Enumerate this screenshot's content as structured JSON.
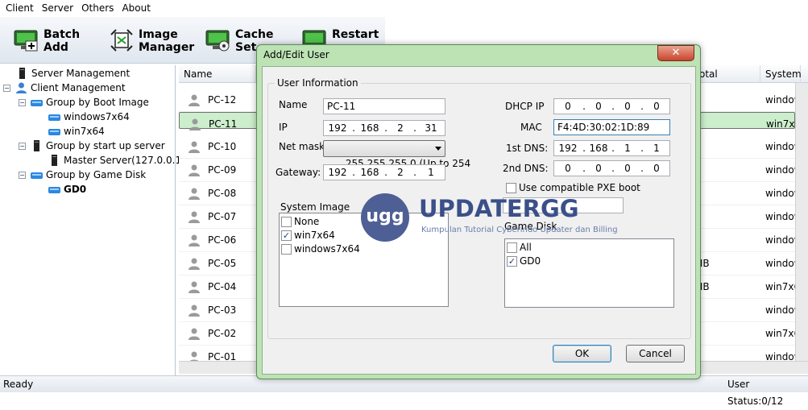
{
  "menu": [
    "Client",
    "Server",
    "Others",
    "About"
  ],
  "toolbar": {
    "batch_add": "Batch\nAdd",
    "image_manager": "Image\nManager",
    "cache_settings": "Cache\nSet",
    "restart": "Restart"
  },
  "tree": {
    "server_management": "Server Management",
    "client_management": "Client Management",
    "group_boot_image": "Group by Boot Image",
    "boot_image_1": "windows7x64",
    "boot_image_2": "win7x64",
    "group_startup_server": "Group by start up server",
    "master_server": "Master Server(127.0.0.1)",
    "group_game_disk": "Group by Game Disk",
    "game_disk_1": "GD0"
  },
  "grid": {
    "col_name": "Name",
    "col_total": "otal",
    "col_system": "System",
    "rows": [
      {
        "name": "PC-12",
        "total": "",
        "system": "window"
      },
      {
        "name": "PC-11",
        "total": "",
        "system": "win7x6"
      },
      {
        "name": "PC-10",
        "total": "",
        "system": "window"
      },
      {
        "name": "PC-09",
        "total": "",
        "system": "window"
      },
      {
        "name": "PC-08",
        "total": "",
        "system": "window"
      },
      {
        "name": "PC-07",
        "total": "",
        "system": "window"
      },
      {
        "name": "PC-06",
        "total": "",
        "system": "window"
      },
      {
        "name": "PC-05",
        "total": "MB",
        "system": "window"
      },
      {
        "name": "PC-04",
        "total": "MB",
        "system": "win7x6"
      },
      {
        "name": "PC-03",
        "total": "",
        "system": "window"
      },
      {
        "name": "PC-02",
        "total": "B",
        "system": "win7x6"
      },
      {
        "name": "PC-01",
        "total": "",
        "system": "window"
      }
    ]
  },
  "status": {
    "left": "Ready",
    "right": "User Status:0/12"
  },
  "dialog": {
    "title": "Add/Edit User",
    "user_info_legend": "User Information",
    "name_label": "Name",
    "name_value": "PC-11",
    "ip_label": "IP",
    "ip": [
      "192",
      "168",
      "2",
      "31"
    ],
    "netmask_label": "Net mask",
    "netmask_value": "255.255.255.0 (Up to 254",
    "gateway_label": "Gateway:",
    "gateway": [
      "192",
      "168",
      "2",
      "1"
    ],
    "dhcp_label": "DHCP IP",
    "dhcp": [
      "0",
      "0",
      "0",
      "0"
    ],
    "mac_label": "MAC",
    "mac_value": "F4:4D:30:02:1D:89",
    "dns1_label": "1st DNS:",
    "dns1": [
      "192",
      "168",
      "1",
      "1"
    ],
    "dns2_label": "2nd DNS:",
    "dns2": [
      "0",
      "0",
      "0",
      "0"
    ],
    "pxe_label": "Use compatible PXE boot",
    "system_image_label": "System Image",
    "system_images": [
      {
        "label": "None",
        "checked": false
      },
      {
        "label": "win7x64",
        "checked": true
      },
      {
        "label": "windows7x64",
        "checked": false
      }
    ],
    "game_disk_label": "Game Disk",
    "game_disks": [
      {
        "label": "All",
        "checked": false
      },
      {
        "label": "GD0",
        "checked": true
      }
    ],
    "ok": "OK",
    "cancel": "Cancel"
  },
  "watermark": {
    "logo": "ugg",
    "title": "UPDATERGG",
    "subtitle": "Kumpulan Tutorial Cyberindo Updater dan Billing"
  }
}
